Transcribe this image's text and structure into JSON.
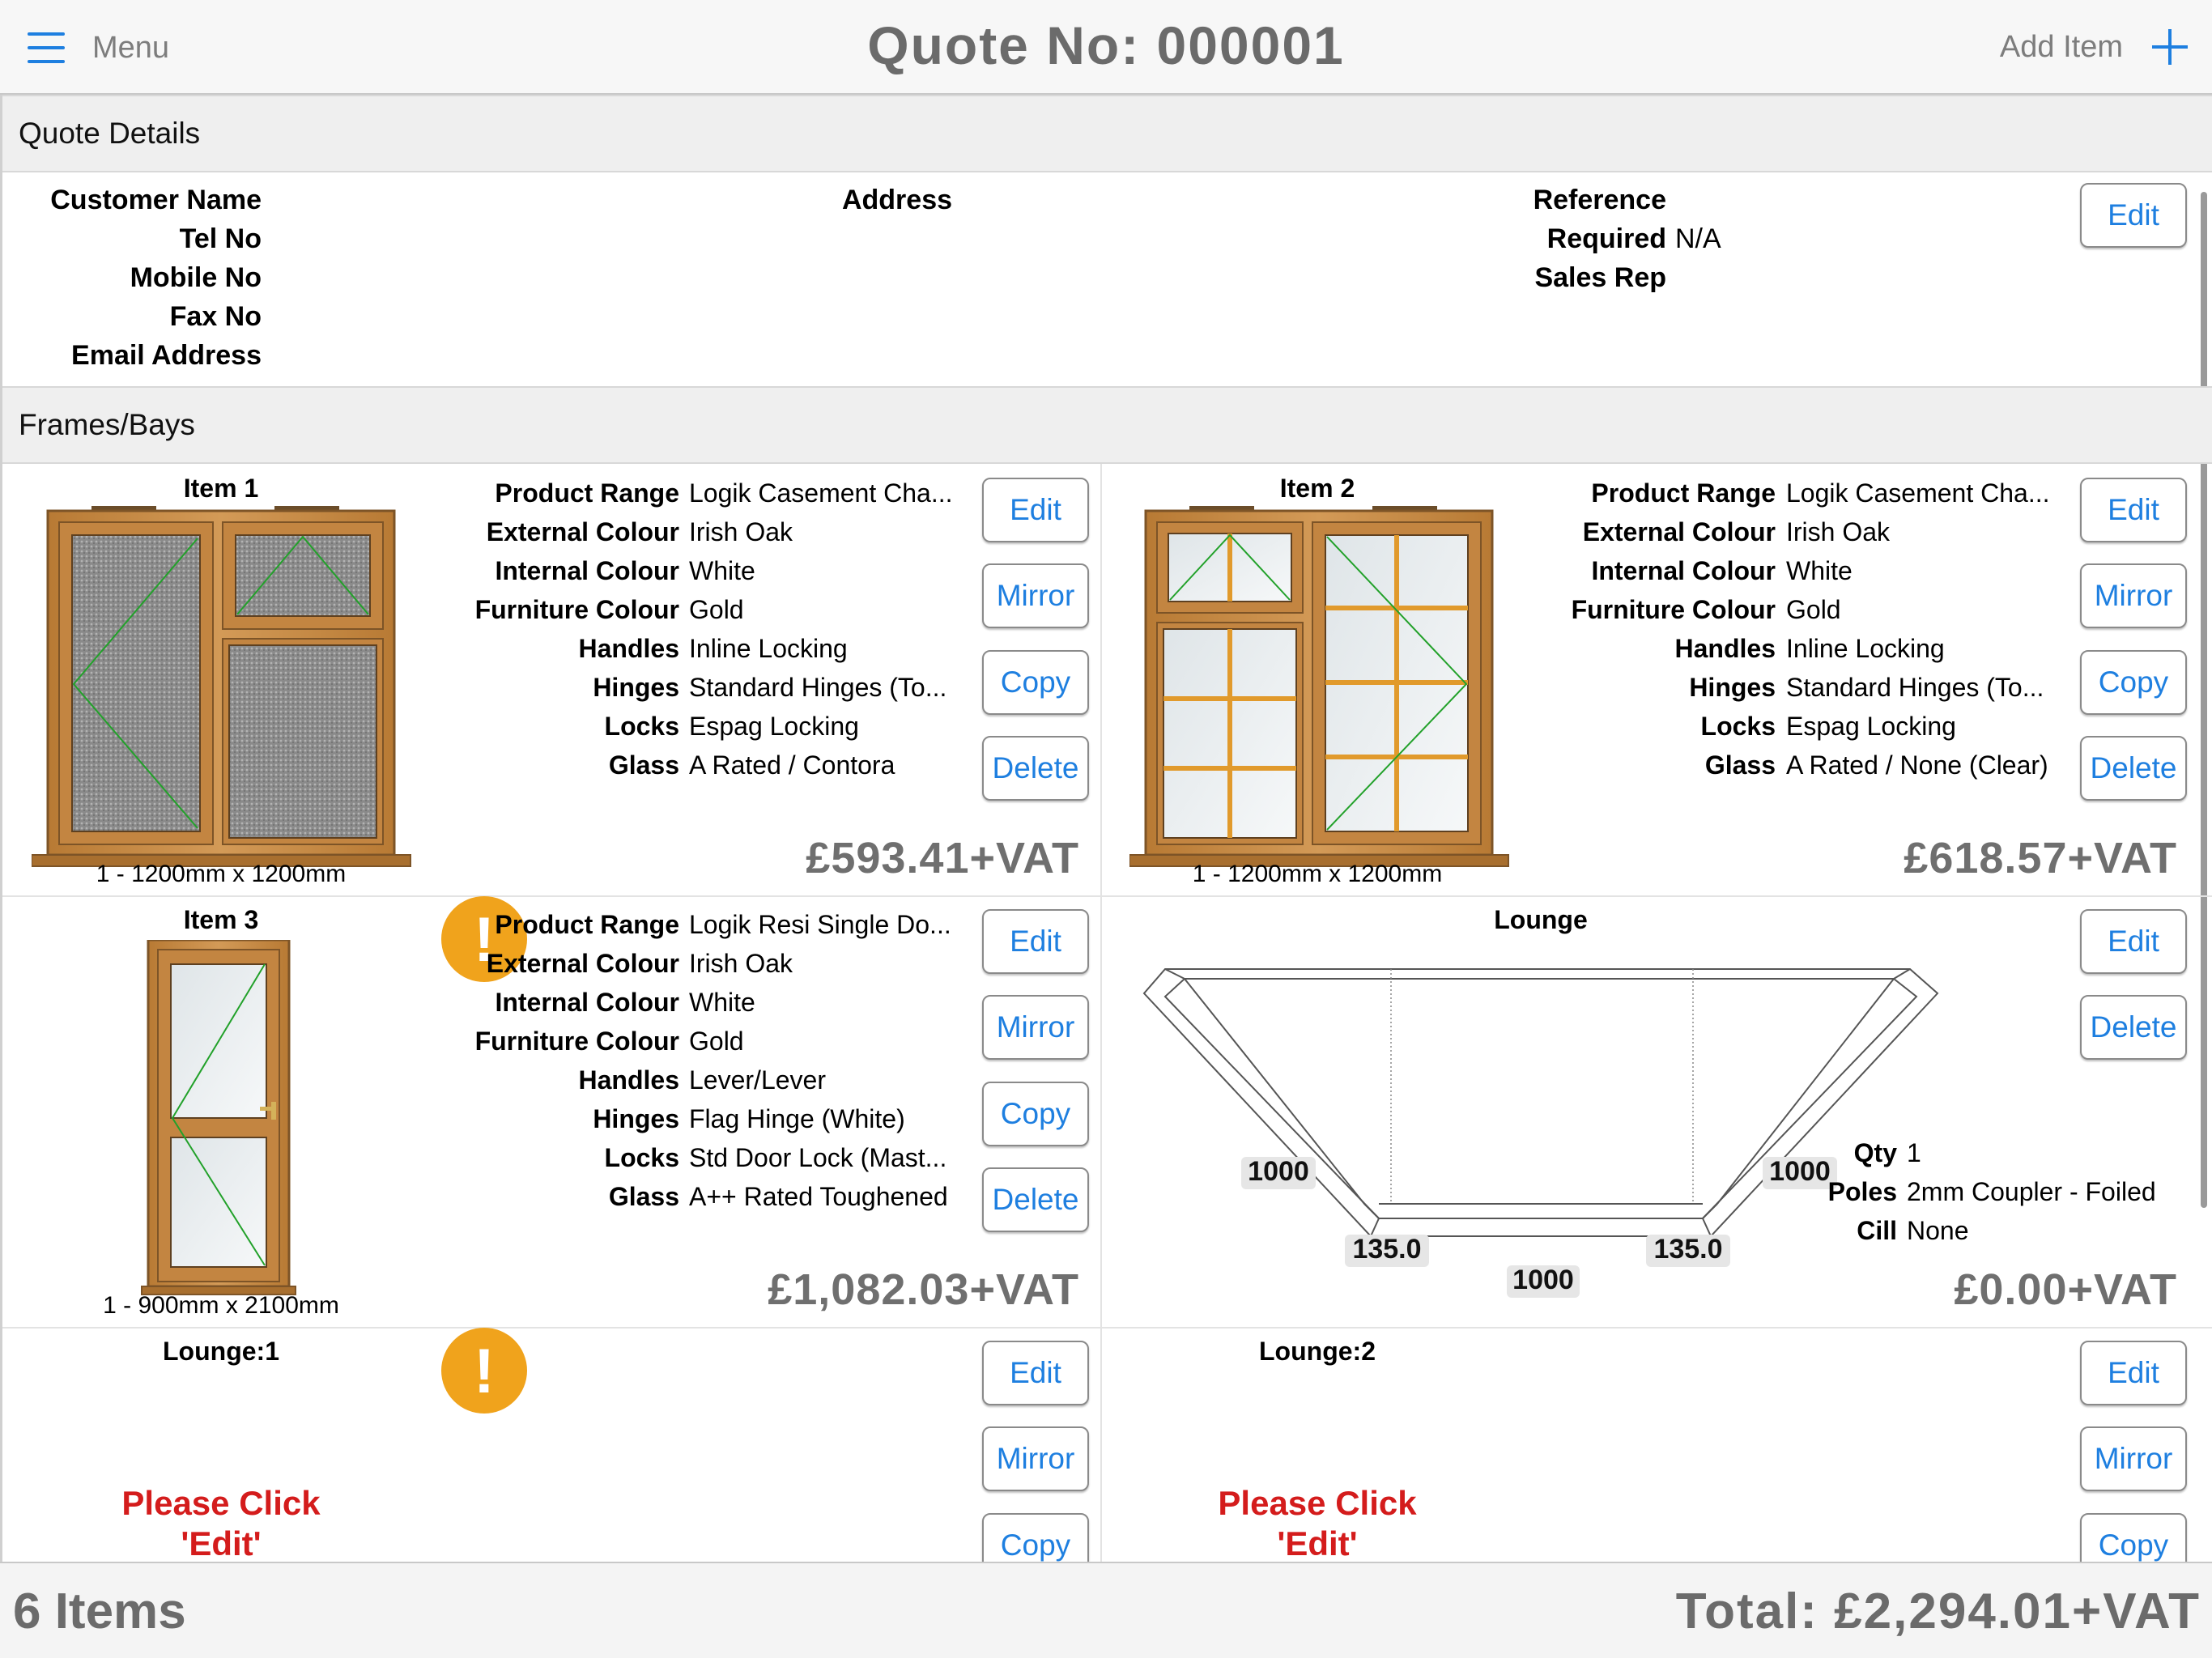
{
  "header": {
    "menu_label": "Menu",
    "title": "Quote No: 000001",
    "add_item_label": "Add Item"
  },
  "quote_details": {
    "section_title": "Quote Details",
    "labels": {
      "customer_name": "Customer Name",
      "tel_no": "Tel No",
      "mobile_no": "Mobile No",
      "fax_no": "Fax No",
      "email": "Email Address",
      "address": "Address",
      "reference": "Reference",
      "required": "Required",
      "sales_rep": "Sales Rep"
    },
    "values": {
      "required": "N/A"
    },
    "edit_label": "Edit"
  },
  "frames": {
    "section_title": "Frames/Bays",
    "spec_labels": [
      "Product Range",
      "External Colour",
      "Internal Colour",
      "Furniture Colour",
      "Handles",
      "Hinges",
      "Locks",
      "Glass"
    ],
    "buttons": {
      "edit": "Edit",
      "mirror": "Mirror",
      "copy": "Copy",
      "delete": "Delete"
    },
    "items": [
      {
        "title": "Item 1",
        "size": "1 - 1200mm x 1200mm",
        "specs": [
          "Logik Casement Cha...",
          "Irish Oak",
          "White",
          "Gold",
          "Inline Locking",
          "Standard Hinges (To...",
          "Espag Locking",
          "A Rated / Contora"
        ],
        "price": "£593.41+VAT",
        "warning": "!"
      },
      {
        "title": "Item 2",
        "size": "1 - 1200mm x 1200mm",
        "specs": [
          "Logik Casement Cha...",
          "Irish Oak",
          "White",
          "Gold",
          "Inline Locking",
          "Standard Hinges (To...",
          "Espag Locking",
          "A Rated / None (Clear)"
        ],
        "price": "£618.57+VAT"
      },
      {
        "title": "Item 3",
        "size": "1 - 900mm x 2100mm",
        "specs": [
          "Logik Resi Single Do...",
          "Irish Oak",
          "White",
          "Gold",
          "Lever/Lever",
          "Flag Hinge (White)",
          "Std Door Lock (Mast...",
          "A++ Rated Toughened"
        ],
        "price": "£1,082.03+VAT",
        "warning": "!"
      }
    ],
    "bay": {
      "title": "Lounge",
      "dims": {
        "left": "1000",
        "right": "1000",
        "center": "1000",
        "angle_left": "135.0",
        "angle_right": "135.0"
      },
      "labels": {
        "qty": "Qty",
        "poles": "Poles",
        "cill": "Cill"
      },
      "values": {
        "qty": "1",
        "poles": "2mm Coupler - Foiled",
        "cill": "None"
      },
      "price": "£0.00+VAT"
    },
    "lounge_items": [
      {
        "title": "Lounge:1",
        "prompt": "Please Click 'Edit'"
      },
      {
        "title": "Lounge:2",
        "prompt": "Please Click 'Edit'"
      }
    ]
  },
  "footer": {
    "item_count": "6 Items",
    "total": "Total:  £2,294.01+VAT"
  },
  "colors": {
    "accent": "#1e7fe0",
    "warning": "#f0a31c",
    "prompt_red": "#d41c1c",
    "price_grey": "#6f6f6f",
    "oak": "#c7893f"
  }
}
